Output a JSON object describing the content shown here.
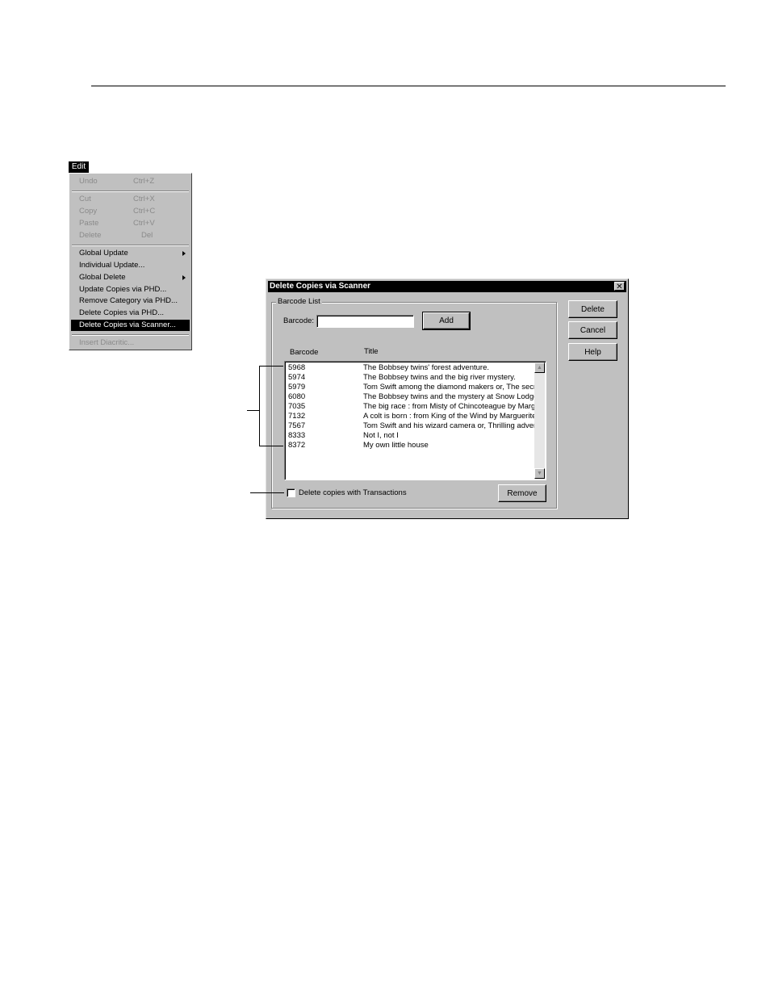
{
  "menu": {
    "title": "Edit",
    "items": [
      {
        "label": "Undo",
        "shortcut": "Ctrl+Z",
        "disabled": true
      },
      {
        "label": "Cut",
        "shortcut": "Ctrl+X",
        "disabled": true
      },
      {
        "label": "Copy",
        "shortcut": "Ctrl+C",
        "disabled": true
      },
      {
        "label": "Paste",
        "shortcut": "Ctrl+V",
        "disabled": true
      },
      {
        "label": "Delete",
        "shortcut": "Del",
        "disabled": true
      },
      {
        "label": "Global Update",
        "submenu": true
      },
      {
        "label": "Individual Update..."
      },
      {
        "label": "Global Delete",
        "submenu": true
      },
      {
        "label": "Update Copies via PHD..."
      },
      {
        "label": "Remove Category via PHD..."
      },
      {
        "label": "Delete Copies via PHD..."
      },
      {
        "label": "Delete Copies via Scanner...",
        "highlighted": true
      },
      {
        "label": "Insert Diacritic...",
        "disabled": true
      }
    ]
  },
  "dialog": {
    "title": "Delete Copies via Scanner",
    "close_glyph": "✕",
    "group_label": "Barcode List",
    "barcode_label": "Barcode:",
    "barcode_value": "",
    "add_button": "Add",
    "col_barcode": "Barcode",
    "col_title": "Title",
    "rows": [
      {
        "barcode": "5968",
        "title": "The Bobbsey twins' forest adventure."
      },
      {
        "barcode": "5974",
        "title": "The Bobbsey twins and the big river mystery."
      },
      {
        "barcode": "5979",
        "title": "Tom Swift among the diamond makers or, The secret"
      },
      {
        "barcode": "6080",
        "title": "The Bobbsey twins and the mystery at Snow Lodge."
      },
      {
        "barcode": "7035",
        "title": "The big race : from Misty of Chincoteague by Margue"
      },
      {
        "barcode": "7132",
        "title": "A colt is born : from King of the Wind by Marguerite H"
      },
      {
        "barcode": "7567",
        "title": "Tom Swift and his wizard camera or, Thrilling adventu"
      },
      {
        "barcode": "8333",
        "title": "Not I, not I"
      },
      {
        "barcode": "8372",
        "title": "My own little house"
      }
    ],
    "checkbox_label": "Delete copies with Transactions",
    "checkbox_checked": false,
    "remove_button": "Remove",
    "delete_button": "Delete",
    "cancel_button": "Cancel",
    "help_button": "Help",
    "scroll_up": "▲",
    "scroll_down": "▼"
  }
}
